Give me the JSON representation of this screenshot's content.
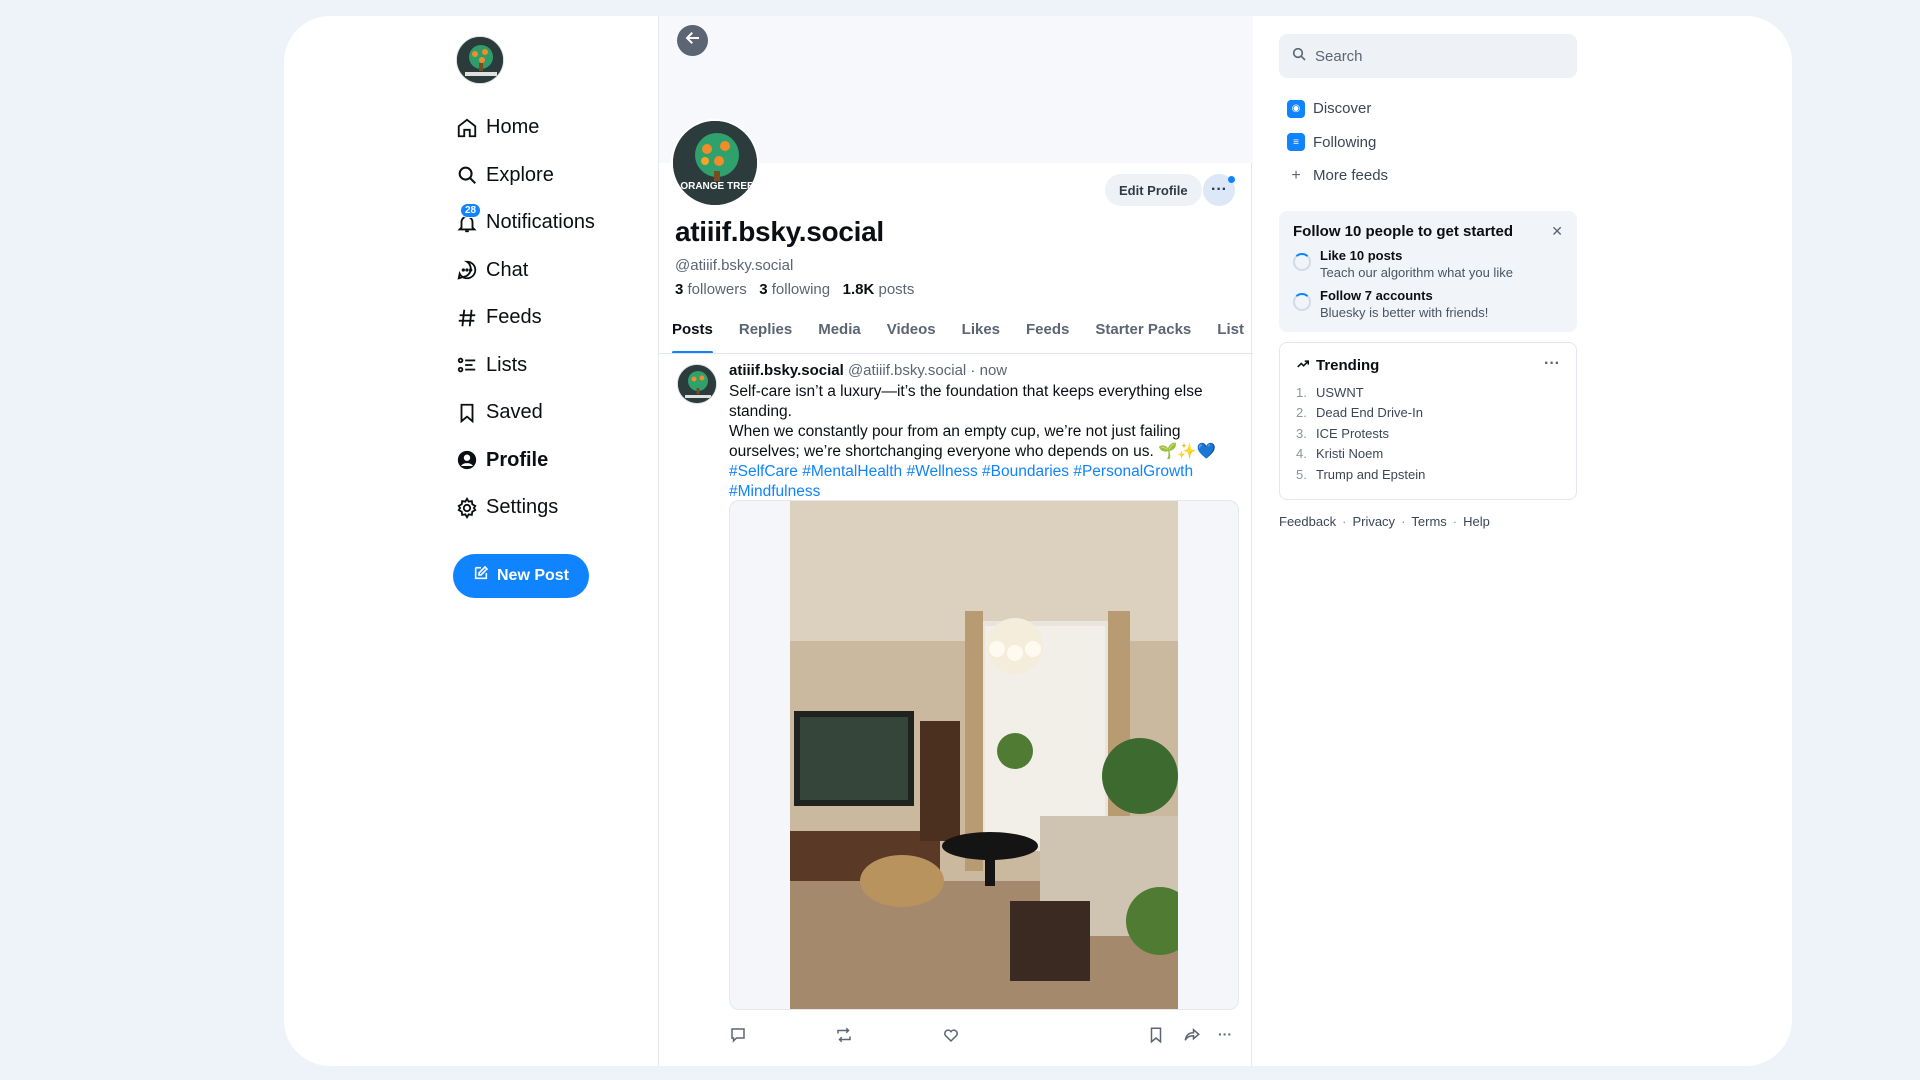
{
  "nav": {
    "items": [
      {
        "label": "Home",
        "icon": "home-icon"
      },
      {
        "label": "Explore",
        "icon": "search-icon"
      },
      {
        "label": "Notifications",
        "icon": "bell-icon",
        "badge": "28"
      },
      {
        "label": "Chat",
        "icon": "chat-icon"
      },
      {
        "label": "Feeds",
        "icon": "hash-icon"
      },
      {
        "label": "Lists",
        "icon": "list-icon"
      },
      {
        "label": "Saved",
        "icon": "bookmark-icon"
      },
      {
        "label": "Profile",
        "icon": "person-icon",
        "active": true
      },
      {
        "label": "Settings",
        "icon": "gear-icon"
      }
    ],
    "new_post_label": "New Post",
    "accent": "#1083fe"
  },
  "profile": {
    "display_name": "atiiif.bsky.social",
    "handle": "@atiiif.bsky.social",
    "followers_count": "3",
    "followers_label": "followers",
    "following_count": "3",
    "following_label": "following",
    "posts_count": "1.8K",
    "posts_label": "posts",
    "edit_label": "Edit Profile",
    "logo_text": "ORANGE TREE"
  },
  "tabs": [
    "Posts",
    "Replies",
    "Media",
    "Videos",
    "Likes",
    "Feeds",
    "Starter Packs",
    "List"
  ],
  "post": {
    "author": "atiiif.bsky.social",
    "meta": "@atiiif.bsky.social · now",
    "line1": "Self-care isn’t a luxury—it’s the foundation that keeps everything else standing.",
    "line2": "When we constantly pour from an empty cup, we’re not just failing ourselves; we’re shortchanging everyone who depends on us. 🌱✨💙",
    "tags": "#SelfCare #MentalHealth #Wellness #Boundaries #PersonalGrowth #Mindfulness"
  },
  "right": {
    "search_placeholder": "Search",
    "feeds": [
      {
        "label": "Discover",
        "icon": "discover-icon"
      },
      {
        "label": "Following",
        "icon": "following-icon"
      },
      {
        "label": "More feeds",
        "icon": "plus-icon"
      }
    ],
    "onboarding": {
      "title": "Follow 10 people to get started",
      "tasks": [
        {
          "title": "Like 10 posts",
          "subtitle": "Teach our algorithm what you like"
        },
        {
          "title": "Follow 7 accounts",
          "subtitle": "Bluesky is better with friends!"
        }
      ]
    },
    "trending": {
      "title": "Trending",
      "items": [
        {
          "n": "1.",
          "label": "USWNT"
        },
        {
          "n": "2.",
          "label": "Dead End Drive-In"
        },
        {
          "n": "3.",
          "label": "ICE Protests"
        },
        {
          "n": "4.",
          "label": "Kristi Noem"
        },
        {
          "n": "5.",
          "label": "Trump and Epstein"
        }
      ]
    },
    "footer": [
      "Feedback",
      "Privacy",
      "Terms",
      "Help"
    ]
  }
}
